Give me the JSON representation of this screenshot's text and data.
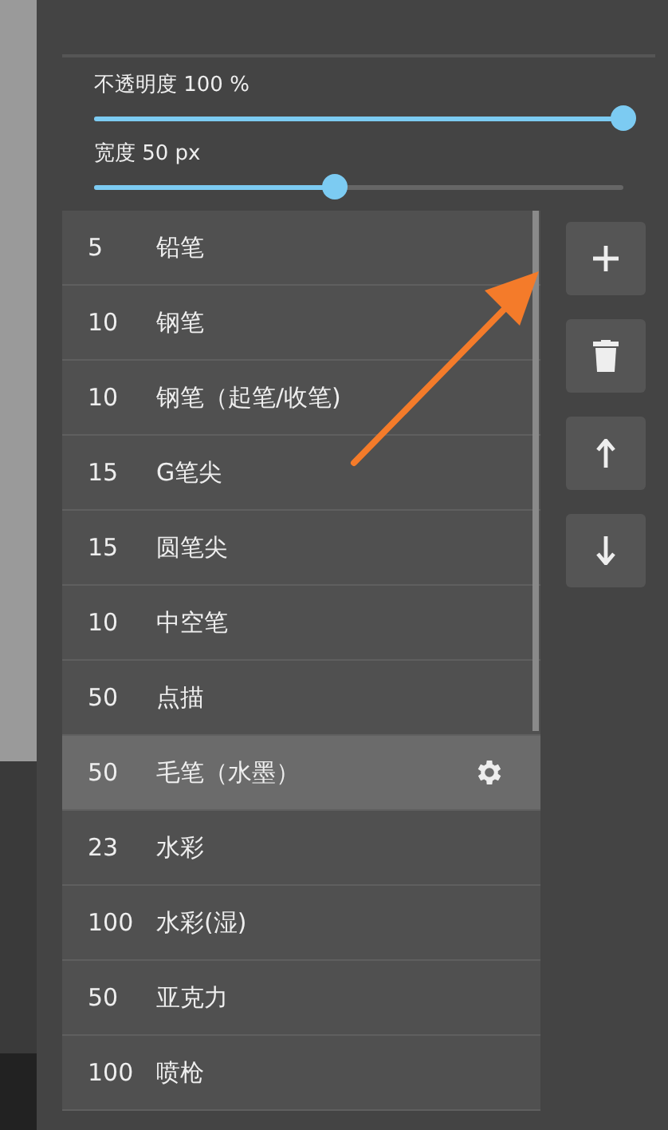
{
  "sliders": [
    {
      "label": "不透明度 100 %",
      "level": 1
    },
    {
      "label": "宽度 50 px",
      "level": 0.455
    }
  ],
  "brushes": [
    {
      "size": "5",
      "name": "铅笔",
      "selected": false
    },
    {
      "size": "10",
      "name": "钢笔",
      "selected": false
    },
    {
      "size": "10",
      "name": "钢笔（起笔/收笔)",
      "selected": false
    },
    {
      "size": "15",
      "name": "G笔尖",
      "selected": false
    },
    {
      "size": "15",
      "name": "圆笔尖",
      "selected": false
    },
    {
      "size": "10",
      "name": "中空笔",
      "selected": false
    },
    {
      "size": "50",
      "name": "点描",
      "selected": false
    },
    {
      "size": "50",
      "name": "毛笔（水墨）",
      "selected": true
    },
    {
      "size": "23",
      "name": "水彩",
      "selected": false
    },
    {
      "size": "100",
      "name": "水彩(湿)",
      "selected": false
    },
    {
      "size": "50",
      "name": "亚克力",
      "selected": false
    },
    {
      "size": "100",
      "name": "喷枪",
      "selected": false
    }
  ],
  "actions": [
    {
      "kind": "add"
    },
    {
      "kind": "delete"
    },
    {
      "kind": "up"
    },
    {
      "kind": "down"
    }
  ]
}
